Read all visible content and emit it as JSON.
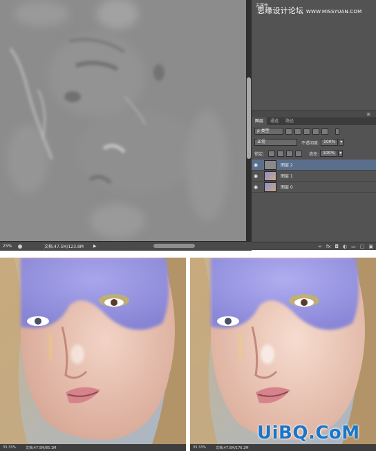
{
  "watermark_top": {
    "text": "思缘设计论坛",
    "url": "WWW.MISSYUAN.COM"
  },
  "panel_title": "无属性",
  "canvas_status": {
    "zoom": "25%",
    "doc": "文档:47.5M/123.8M"
  },
  "layers_panel": {
    "tabs": [
      "图层",
      "通道",
      "路径"
    ],
    "filter_kind": "ρ 类型",
    "blend_mode": "正常",
    "opacity_label": "不透明度:",
    "opacity_value": "100%",
    "lock_label": "锁定:",
    "fill_label": "填充:",
    "fill_value": "100%",
    "layers": [
      {
        "name": "图层 2",
        "selected": true
      },
      {
        "name": "图层 1",
        "selected": false
      },
      {
        "name": "图层 0",
        "selected": false
      }
    ]
  },
  "before_status": {
    "zoom": "33.33%",
    "doc": "文档:47.5M/85.1M"
  },
  "after_status": {
    "zoom": "33.33%",
    "doc": "文档:47.5M/176.2M"
  },
  "brand": "UiBQ.CoM",
  "colors": {
    "accent_brand": "#1976c8",
    "layer_selected": "#5a6f8c"
  }
}
